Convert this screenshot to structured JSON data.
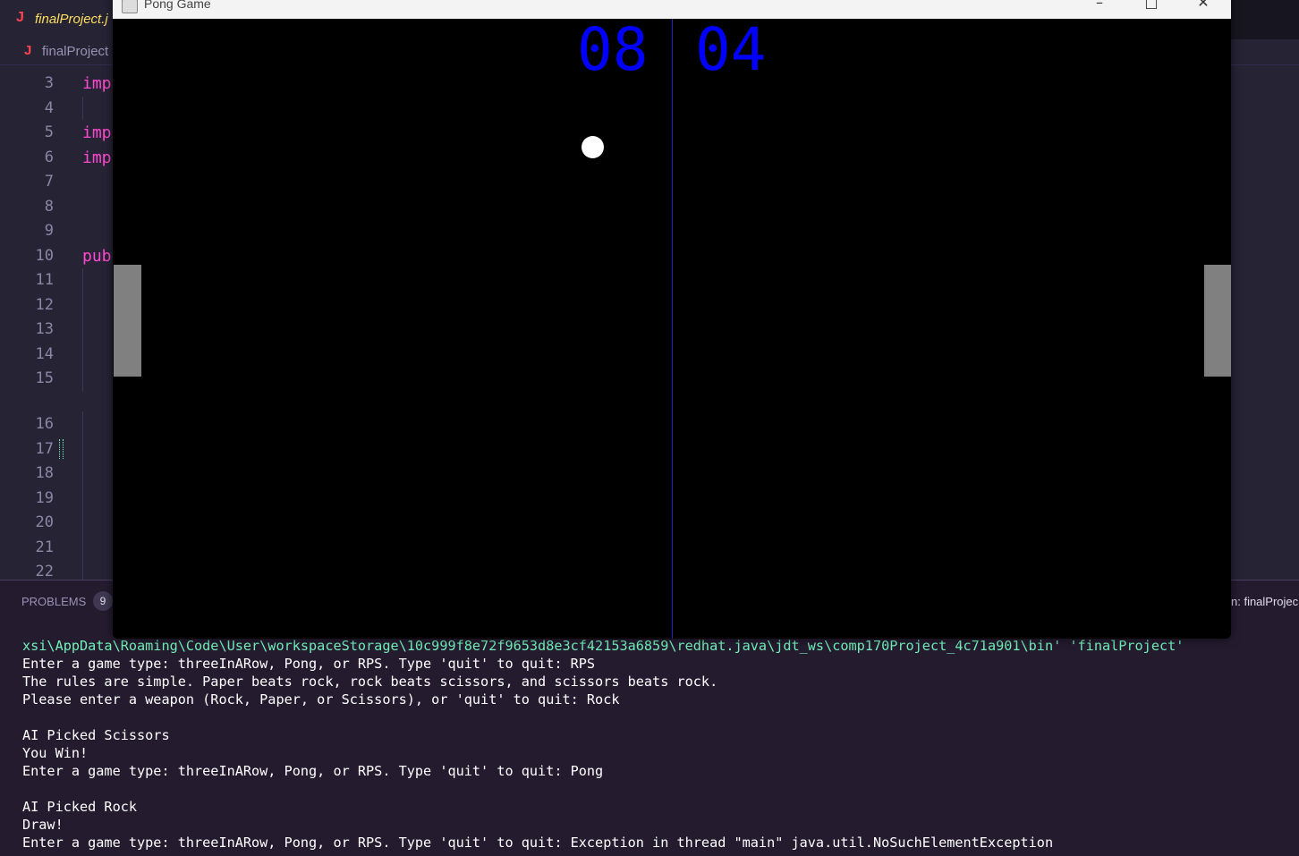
{
  "editor": {
    "tab_icon": "J",
    "tab_label": "finalProject.j",
    "breadcrumb_icon": "J",
    "breadcrumb_label": "finalProject",
    "line_numbers": [
      "3",
      "4",
      "5",
      "6",
      "7",
      "8",
      "9",
      "10",
      "11",
      "12",
      "13",
      "14",
      "15",
      "16",
      "17",
      "18",
      "19",
      "20",
      "21",
      "22"
    ],
    "code_fragments": [
      "imp",
      "imp",
      "imp",
      "pub"
    ]
  },
  "panel": {
    "title": "PROBLEMS",
    "badge": "9",
    "right_label": "n: finalProjec"
  },
  "terminal": {
    "lines": [
      "xsi\\AppData\\Roaming\\Code\\User\\workspaceStorage\\10c999f8e72f9653d8e3cf42153a6859\\redhat.java\\jdt_ws\\comp170Project_4c71a901\\bin' 'finalProject'",
      "Enter a game type: threeInARow, Pong, or RPS. Type 'quit' to quit: RPS",
      "The rules are simple. Paper beats rock, rock beats scissors, and scissors beats rock.",
      "Please enter a weapon (Rock, Paper, or Scissors), or 'quit' to quit: Rock",
      "",
      "AI Picked Scissors",
      "You Win!",
      "Enter a game type: threeInARow, Pong, or RPS. Type 'quit' to quit: Pong",
      "",
      "AI Picked Rock",
      "Draw!",
      "Enter a game type: threeInARow, Pong, or RPS. Type 'quit' to quit: Exception in thread \"main\" java.util.NoSuchElementException"
    ]
  },
  "game": {
    "window_title": "Pong Game",
    "minimize_glyph": "–",
    "maximize_glyph": "□",
    "close_glyph": "✕",
    "score_left": "08",
    "score_right": "04",
    "colors": {
      "score": "#0000ff",
      "center_line": "#2222cc",
      "paddle": "#808080",
      "ball": "#ffffff",
      "court": "#000000"
    }
  }
}
